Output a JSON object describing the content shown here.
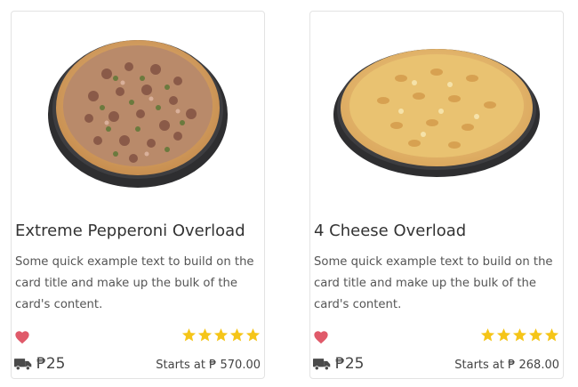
{
  "cards": [
    {
      "title": "Extreme Pepperoni Overload",
      "text": "Some quick example text to build on the card title and make up the bulk of the card's content.",
      "delivery_fee": "₱25",
      "price": "Starts at ₱ 570.00",
      "rating": 5,
      "image": "pepperoni-pizza"
    },
    {
      "title": "4 Cheese Overload",
      "text": "Some quick example text to build on the card title and make up the bulk of the card's content.",
      "delivery_fee": "₱25",
      "price": "Starts at ₱ 268.00",
      "rating": 5,
      "image": "cheese-pizza"
    }
  ],
  "icons": {
    "favorite": "heart-icon",
    "delivery": "truck-icon",
    "rating": "star-icon"
  },
  "colors": {
    "heart": "#e05a6a",
    "star": "#f5c518",
    "border": "#e3e3e3"
  }
}
